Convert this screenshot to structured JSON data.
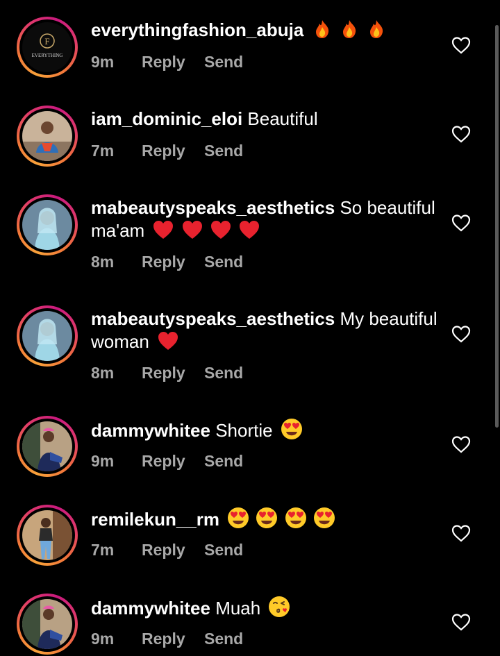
{
  "comments": [
    {
      "username": "everythingfashion_abuja",
      "text": "",
      "emoji": [
        "fire-emoji",
        "fire-emoji",
        "fire-emoji"
      ],
      "time": "9m",
      "reply_label": "Reply",
      "send_label": "Send",
      "avatar_logo_text": "EVERYTHING",
      "avatar_logo_letter": "F"
    },
    {
      "username": "iam_dominic_eloi",
      "text": "Beautiful",
      "emoji": [],
      "time": "7m",
      "reply_label": "Reply",
      "send_label": "Send"
    },
    {
      "username": "mabeautyspeaks_aesthetics",
      "text": "So beautiful ma'am",
      "emoji": [
        "red-heart-emoji",
        "red-heart-emoji",
        "red-heart-emoji",
        "red-heart-emoji"
      ],
      "time": "8m",
      "reply_label": "Reply",
      "send_label": "Send"
    },
    {
      "username": "mabeautyspeaks_aesthetics",
      "text": "My beautiful woman",
      "emoji": [
        "red-heart-emoji"
      ],
      "time": "8m",
      "reply_label": "Reply",
      "send_label": "Send"
    },
    {
      "username": "dammywhitee",
      "text": "Shortie",
      "emoji": [
        "heart-eyes-emoji"
      ],
      "time": "9m",
      "reply_label": "Reply",
      "send_label": "Send"
    },
    {
      "username": "remilekun__rm",
      "text": "",
      "emoji": [
        "heart-eyes-emoji",
        "heart-eyes-emoji",
        "heart-eyes-emoji",
        "heart-eyes-emoji"
      ],
      "time": "7m",
      "reply_label": "Reply",
      "send_label": "Send"
    },
    {
      "username": "dammywhitee",
      "text": "Muah",
      "emoji": [
        "face-blowing-kiss-emoji"
      ],
      "time": "9m",
      "reply_label": "Reply",
      "send_label": "Send"
    }
  ],
  "colors": {
    "background": "#000000",
    "primary_text": "#ffffff",
    "secondary_text": "#a8a8a8",
    "story_ring_start": "#f9a23a",
    "story_ring_end": "#c9197e"
  },
  "icons": {
    "like": "heart-outline-icon"
  }
}
